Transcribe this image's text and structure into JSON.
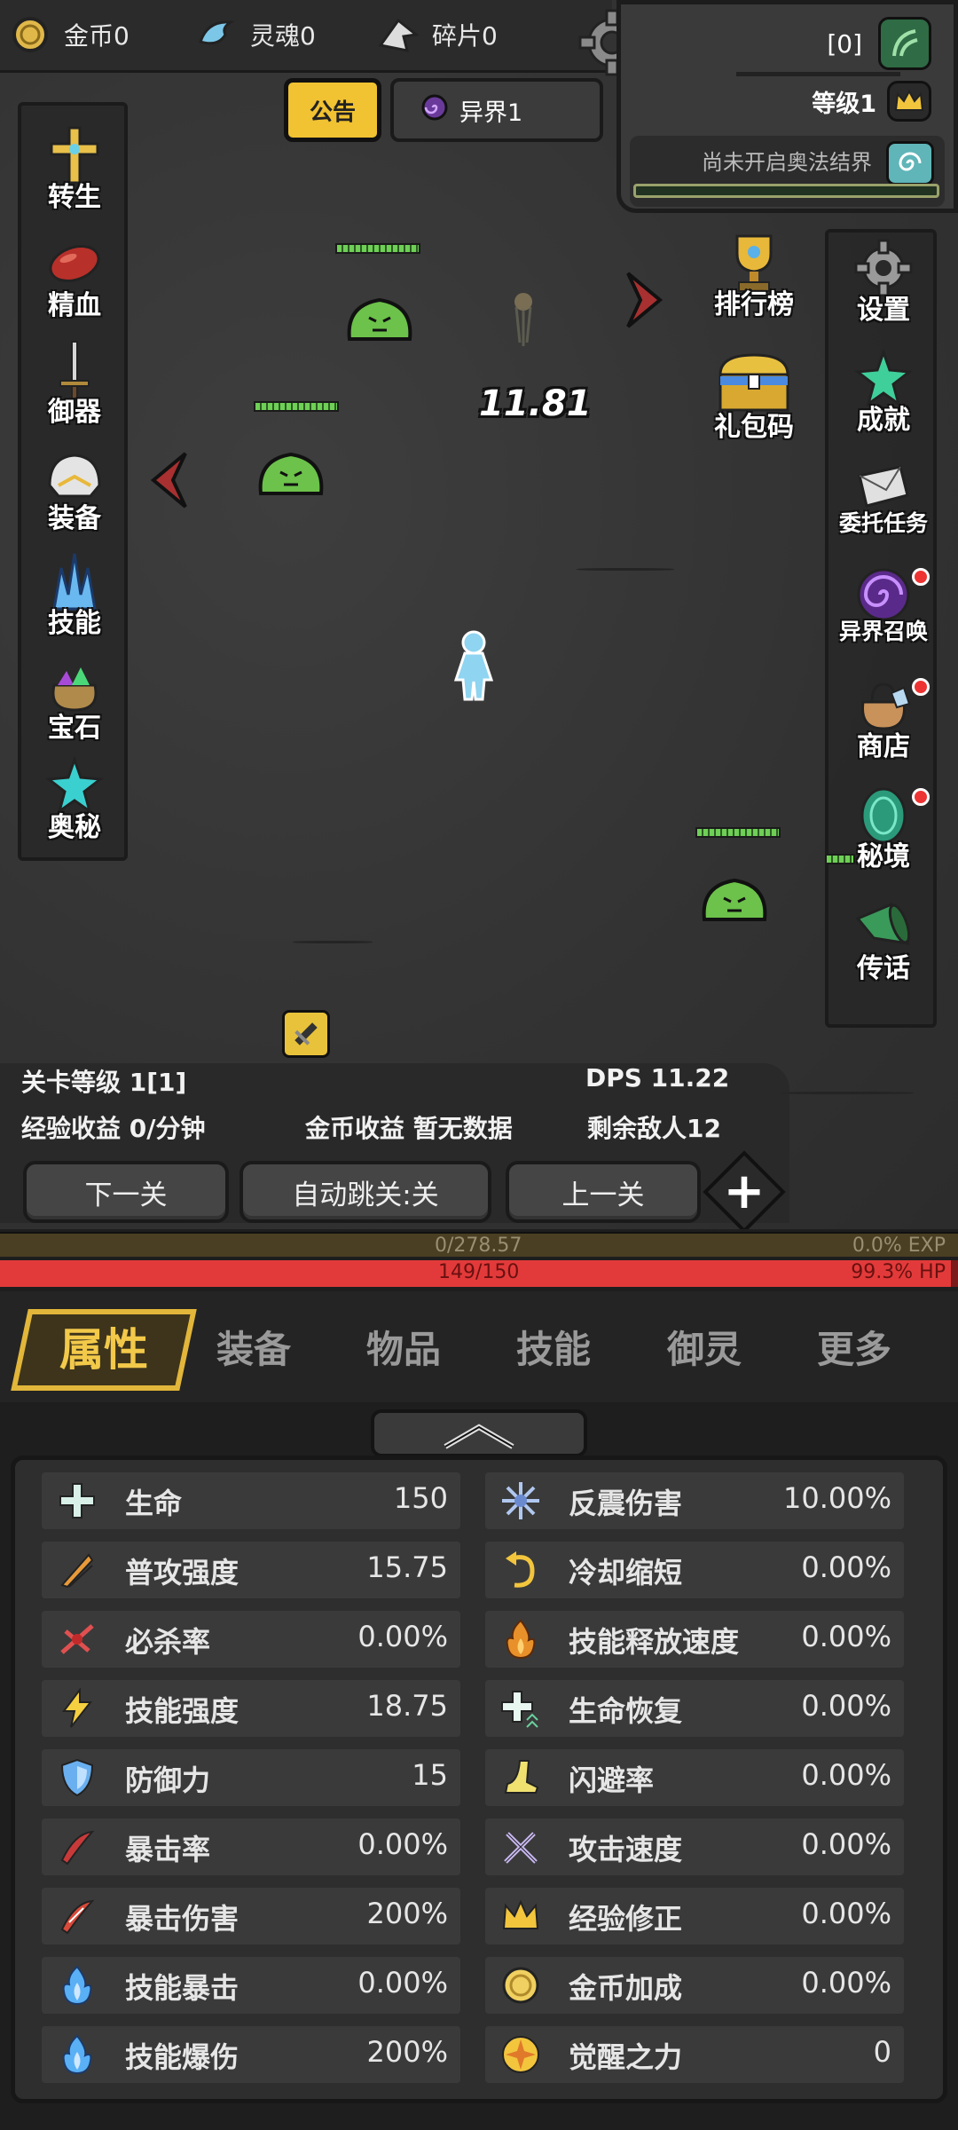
{
  "currencies": [
    {
      "label": "金币0",
      "icon": "gold-coin-icon"
    },
    {
      "label": "灵魂0",
      "icon": "soul-icon"
    },
    {
      "label": "碎片0",
      "icon": "fragment-icon"
    }
  ],
  "player": {
    "bracket_text": "[0]",
    "level": "等级1",
    "arcane_barrier": "尚未开启奥法结界"
  },
  "notice_label": "公告",
  "realm_label": "异界1",
  "left_menu": [
    {
      "label": "转生",
      "icon": "rebirth-cross-icon"
    },
    {
      "label": "精血",
      "icon": "blood-meat-icon"
    },
    {
      "label": "御器",
      "icon": "sword-icon"
    },
    {
      "label": "装备",
      "icon": "helmet-icon"
    },
    {
      "label": "技能",
      "icon": "ice-crystal-icon"
    },
    {
      "label": "宝石",
      "icon": "gem-bag-icon"
    },
    {
      "label": "奥秘",
      "icon": "arcane-star-icon"
    }
  ],
  "mid_menu": [
    {
      "label": "排行榜",
      "icon": "trophy-icon"
    },
    {
      "label": "礼包码",
      "icon": "treasure-chest-icon"
    }
  ],
  "right_menu": [
    {
      "label": "设置",
      "icon": "gear-icon"
    },
    {
      "label": "成就",
      "icon": "star-icon"
    },
    {
      "label": "委托任务",
      "icon": "letter-icon"
    },
    {
      "label": "异界召唤",
      "icon": "vortex-icon"
    },
    {
      "label": "商店",
      "icon": "shop-bag-icon"
    },
    {
      "label": "秘境",
      "icon": "portal-icon"
    },
    {
      "label": "传话",
      "icon": "horn-icon"
    }
  ],
  "damage_number": "11.81",
  "stage": {
    "level": "关卡等级 1[1]",
    "dps": "DPS 11.22",
    "exp_income": "经验收益 0/分钟",
    "gold_income": "金币收益 暂无数据",
    "enemies_left": "剩余敌人12"
  },
  "buttons": {
    "next": "下一关",
    "auto": "自动跳关:关",
    "prev": "上一关",
    "plus": "+"
  },
  "exp": {
    "value": "0/278.57",
    "percent": "0.0% EXP",
    "fill": 0.0
  },
  "hp": {
    "value": "149/150",
    "percent": "99.3%  HP",
    "fill": 0.993
  },
  "tabs": [
    "属性",
    "装备",
    "物品",
    "技能",
    "御灵",
    "更多"
  ],
  "attributes_left": [
    {
      "name": "生命",
      "value": "150",
      "icon": "life-plus-icon"
    },
    {
      "name": "普攻强度",
      "value": "15.75",
      "icon": "claw-icon"
    },
    {
      "name": "必杀率",
      "value": "0.00%",
      "icon": "critical-slash-icon"
    },
    {
      "name": "技能强度",
      "value": "18.75",
      "icon": "lightning-icon"
    },
    {
      "name": "防御力",
      "value": "15",
      "icon": "shield-icon"
    },
    {
      "name": "暴击率",
      "value": "0.00%",
      "icon": "crit-claw-icon"
    },
    {
      "name": "暴击伤害",
      "value": "200%",
      "icon": "crit-damage-icon"
    },
    {
      "name": "技能暴击",
      "value": "0.00%",
      "icon": "blue-flame-icon"
    },
    {
      "name": "技能爆伤",
      "value": "200%",
      "icon": "blue-flame-icon"
    }
  ],
  "attributes_right": [
    {
      "name": "反震伤害",
      "value": "10.00%",
      "icon": "shock-icon"
    },
    {
      "name": "冷却缩短",
      "value": "0.00%",
      "icon": "cooldown-arrow-icon"
    },
    {
      "name": "技能释放速度",
      "value": "0.00%",
      "icon": "fire-icon"
    },
    {
      "name": "生命恢复",
      "value": "0.00%",
      "icon": "regen-plus-icon"
    },
    {
      "name": "闪避率",
      "value": "0.00%",
      "icon": "boot-icon"
    },
    {
      "name": "攻击速度",
      "value": "0.00%",
      "icon": "crossed-swords-icon"
    },
    {
      "name": "经验修正",
      "value": "0.00%",
      "icon": "crown-icon"
    },
    {
      "name": "金币加成",
      "value": "0.00%",
      "icon": "gold-coin-icon"
    },
    {
      "name": "觉醒之力",
      "value": "0",
      "icon": "compass-star-icon"
    }
  ],
  "colors": {
    "accent_gold": "#f1c232",
    "hp_red": "#e23a3a",
    "slime_green": "#6cc24a"
  }
}
